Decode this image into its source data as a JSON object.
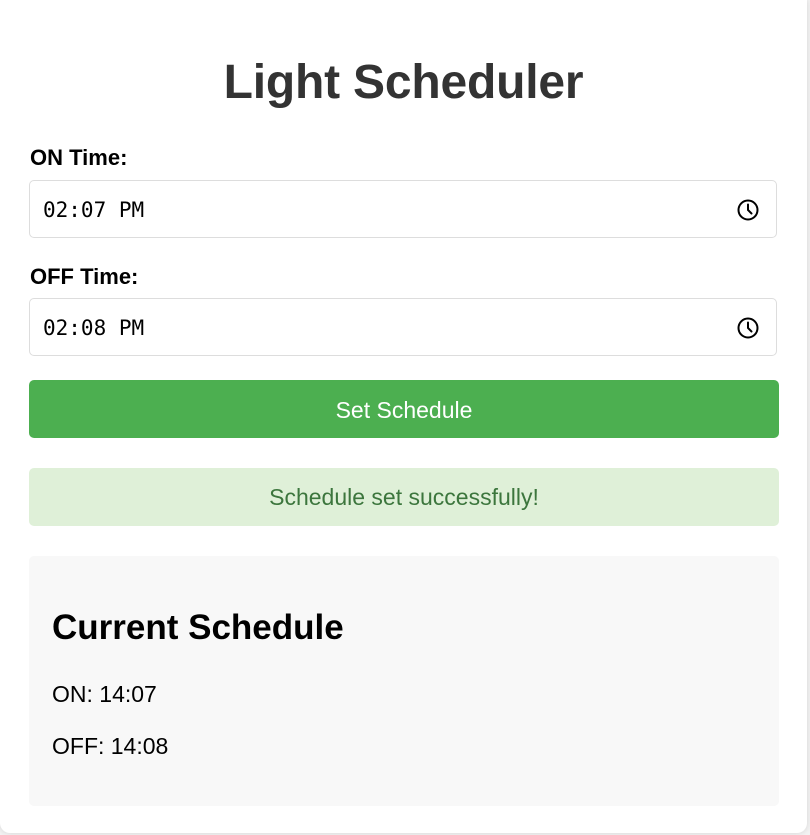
{
  "page": {
    "title": "Light Scheduler"
  },
  "form": {
    "on_label": "ON Time:",
    "on_value": "02:07 PM",
    "off_label": "OFF Time:",
    "off_value": "02:08 PM",
    "submit_label": "Set Schedule"
  },
  "status": {
    "message": "Schedule set successfully!"
  },
  "schedule": {
    "heading": "Current Schedule",
    "on_line": "ON: 14:07",
    "off_line": "OFF: 14:08"
  },
  "icons": {
    "time_picker": "clock-icon"
  },
  "colors": {
    "button": "#4caf50",
    "success_bg": "#dff0d8",
    "success_text": "#3c763d",
    "title": "#333333"
  }
}
